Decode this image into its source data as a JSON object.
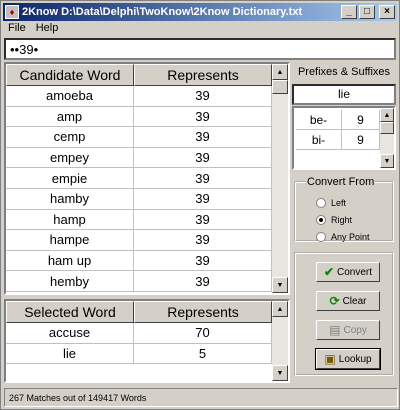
{
  "window": {
    "title": "2Know D:\\Data\\Delphi\\TwoKnow\\2Know Dictionary.txt",
    "controls": {
      "minimize": "_",
      "maximize": "□",
      "close": "×"
    }
  },
  "menu": [
    {
      "label": "File"
    },
    {
      "label": "Help"
    }
  ],
  "search": {
    "value": "••39•"
  },
  "candidates": {
    "headers": [
      "Candidate Word",
      "Represents"
    ],
    "rows": [
      [
        "amoeba",
        "39"
      ],
      [
        "amp",
        "39"
      ],
      [
        "cemp",
        "39"
      ],
      [
        "empey",
        "39"
      ],
      [
        "empie",
        "39"
      ],
      [
        "hamby",
        "39"
      ],
      [
        "hamp",
        "39"
      ],
      [
        "hampe",
        "39"
      ],
      [
        "ham up",
        "39"
      ],
      [
        "hemby",
        "39"
      ]
    ]
  },
  "selected": {
    "headers": [
      "Selected Word",
      "Represents"
    ],
    "rows": [
      [
        "accuse",
        "70"
      ],
      [
        "lie",
        "5"
      ]
    ]
  },
  "prefixes": {
    "title": "Prefixes  & Suffixes",
    "input": "lie",
    "rows": [
      [
        "be-",
        "9"
      ],
      [
        "bi-",
        "9"
      ]
    ]
  },
  "convert_from": {
    "legend": "Convert From",
    "options": [
      "Left",
      "Right",
      "Any Point"
    ],
    "selected": "Right"
  },
  "actions": {
    "convert": "Convert",
    "clear": "Clear",
    "copy": "Copy",
    "lookup": "Lookup"
  },
  "status": "267 Matches out of 149417 Words",
  "icons": [
    "app-icon",
    "check-icon",
    "refresh-icon",
    "copy-icon",
    "lookup-icon",
    "scroll-up-icon",
    "scroll-down-icon"
  ]
}
